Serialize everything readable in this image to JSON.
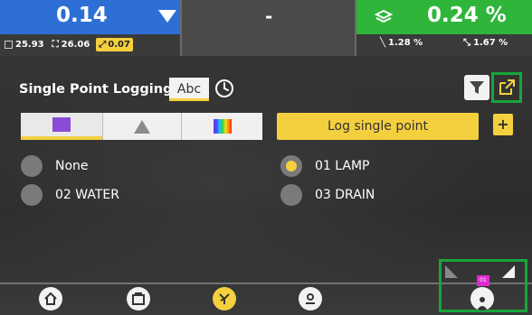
{
  "status": {
    "elevation": {
      "value": "0.14",
      "left_reading": "25.93",
      "right_reading": "26.06",
      "offset": "0.07"
    },
    "center": {
      "value": "-"
    },
    "slope": {
      "value": "0.24 %",
      "cross": "1.28 %",
      "main": "1.67 %"
    }
  },
  "panel": {
    "title": "Single Point Logging",
    "abc_label": "Abc",
    "log_button": "Log single point",
    "plus_label": "+"
  },
  "points": [
    {
      "label": "None",
      "selected": false
    },
    {
      "label": "02 WATER",
      "selected": false
    },
    {
      "label": "01 LAMP",
      "selected": true
    },
    {
      "label": "03 DRAIN",
      "selected": false
    }
  ],
  "nav": {
    "badge_label": "01"
  },
  "colors": {
    "accent": "#f4d03f",
    "blue": "#2e6fd6",
    "green": "#2fb53a",
    "highlight": "#17a63a"
  }
}
